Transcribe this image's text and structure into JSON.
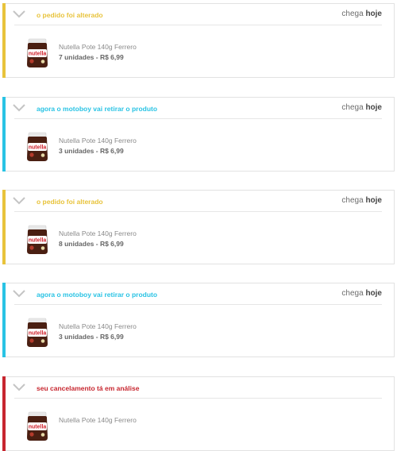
{
  "colors": {
    "altered": "#e8c33b",
    "motoboy": "#29c3e4",
    "cancel": "#c7262f"
  },
  "orders": [
    {
      "status": "o pedido foi alterado",
      "color": "altered",
      "eta_prefix": "chega",
      "eta_day": "hoje",
      "product": "Nutella Pote 140g Ferrero",
      "qty": "7 unidades - R$ 6,99",
      "icon": "nutella-jar-icon"
    },
    {
      "status": "agora o motoboy vai retirar o produto",
      "color": "motoboy",
      "eta_prefix": "chega",
      "eta_day": "hoje",
      "product": "Nutella Pote 140g Ferrero",
      "qty": "3 unidades - R$ 6,99",
      "icon": "nutella-jar-icon"
    },
    {
      "status": "o pedido foi alterado",
      "color": "altered",
      "eta_prefix": "chega",
      "eta_day": "hoje",
      "product": "Nutella Pote 140g Ferrero",
      "qty": "8 unidades - R$ 6,99",
      "icon": "nutella-jar-icon"
    },
    {
      "status": "agora o motoboy vai retirar o produto",
      "color": "motoboy",
      "eta_prefix": "chega",
      "eta_day": "hoje",
      "product": "Nutella Pote 140g Ferrero",
      "qty": "3 unidades - R$ 6,99",
      "icon": "nutella-jar-icon"
    },
    {
      "status": "seu cancelamento tá em análise",
      "color": "cancel",
      "eta_prefix": "",
      "eta_day": "",
      "product": "Nutella Pote 140g Ferrero",
      "qty": "",
      "icon": "nutella-jar-icon"
    }
  ]
}
